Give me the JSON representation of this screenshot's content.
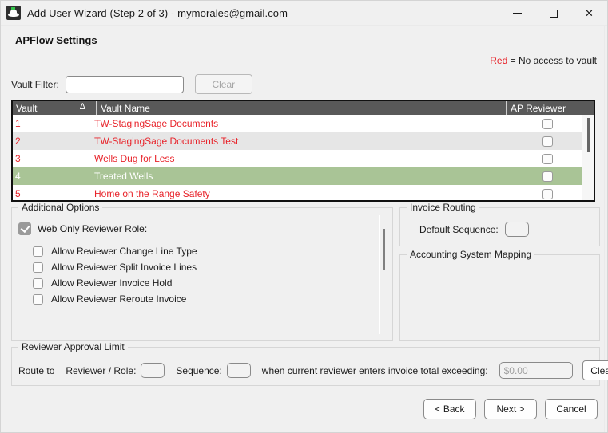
{
  "window": {
    "title": "Add User Wizard (Step 2 of 3) - mymorales@gmail.com",
    "icon": "app-logo-icon",
    "controls": {
      "minimize": "minimize-icon",
      "maximize": "maximize-icon",
      "close": "close-icon"
    }
  },
  "page": {
    "heading": "APFlow Settings"
  },
  "legend": {
    "keyword": "Red",
    "text": "= No access to vault",
    "color": "#e8232a"
  },
  "filter": {
    "label": "Vault Filter:",
    "value": "",
    "placeholder": "",
    "clear_label": "Clear"
  },
  "grid": {
    "columns": [
      "Vault",
      "Vault Name",
      "AP Reviewer"
    ],
    "sort_indicator": "∆",
    "sort_column": "Vault",
    "sort_direction": "ascending",
    "selected_row_index": 3,
    "selection_color": "#a9c496",
    "no_access_color": "#e8232a",
    "rows": [
      {
        "vault": "1",
        "name": "TW-StagingSage Documents",
        "ap_reviewer": false,
        "no_access": true
      },
      {
        "vault": "2",
        "name": "TW-StagingSage Documents Test",
        "ap_reviewer": false,
        "no_access": true
      },
      {
        "vault": "3",
        "name": "Wells Dug for Less",
        "ap_reviewer": false,
        "no_access": true
      },
      {
        "vault": "4",
        "name": "Treated Wells",
        "ap_reviewer": false,
        "no_access": false
      },
      {
        "vault": "5",
        "name": "Home on the Range Safety",
        "ap_reviewer": false,
        "no_access": true
      }
    ]
  },
  "additional_options": {
    "legend": "Additional Options",
    "main": {
      "label": "Web Only Reviewer Role:",
      "checked": true
    },
    "sub": [
      {
        "label": "Allow Reviewer Change Line Type",
        "checked": false
      },
      {
        "label": "Allow Reviewer Split Invoice Lines",
        "checked": false
      },
      {
        "label": "Allow Reviewer Invoice Hold",
        "checked": false
      },
      {
        "label": "Allow Reviewer Reroute Invoice",
        "checked": false
      }
    ]
  },
  "invoice_routing": {
    "legend": "Invoice Routing",
    "default_sequence_label": "Default Sequence:",
    "default_sequence_value": ""
  },
  "accounting_mapping": {
    "legend": "Accounting System Mapping"
  },
  "approval_limit": {
    "legend": "Reviewer Approval Limit",
    "route_to_label": "Route to",
    "reviewer_role_label": "Reviewer / Role:",
    "reviewer_role_value": "",
    "sequence_label": "Sequence:",
    "sequence_value": "",
    "condition_text": "when current reviewer enters invoice total exceeding:",
    "amount_value": "",
    "amount_placeholder": "$0.00",
    "clear_label": "Clear"
  },
  "footer": {
    "back_label": "< Back",
    "next_label": "Next >",
    "cancel_label": "Cancel"
  }
}
